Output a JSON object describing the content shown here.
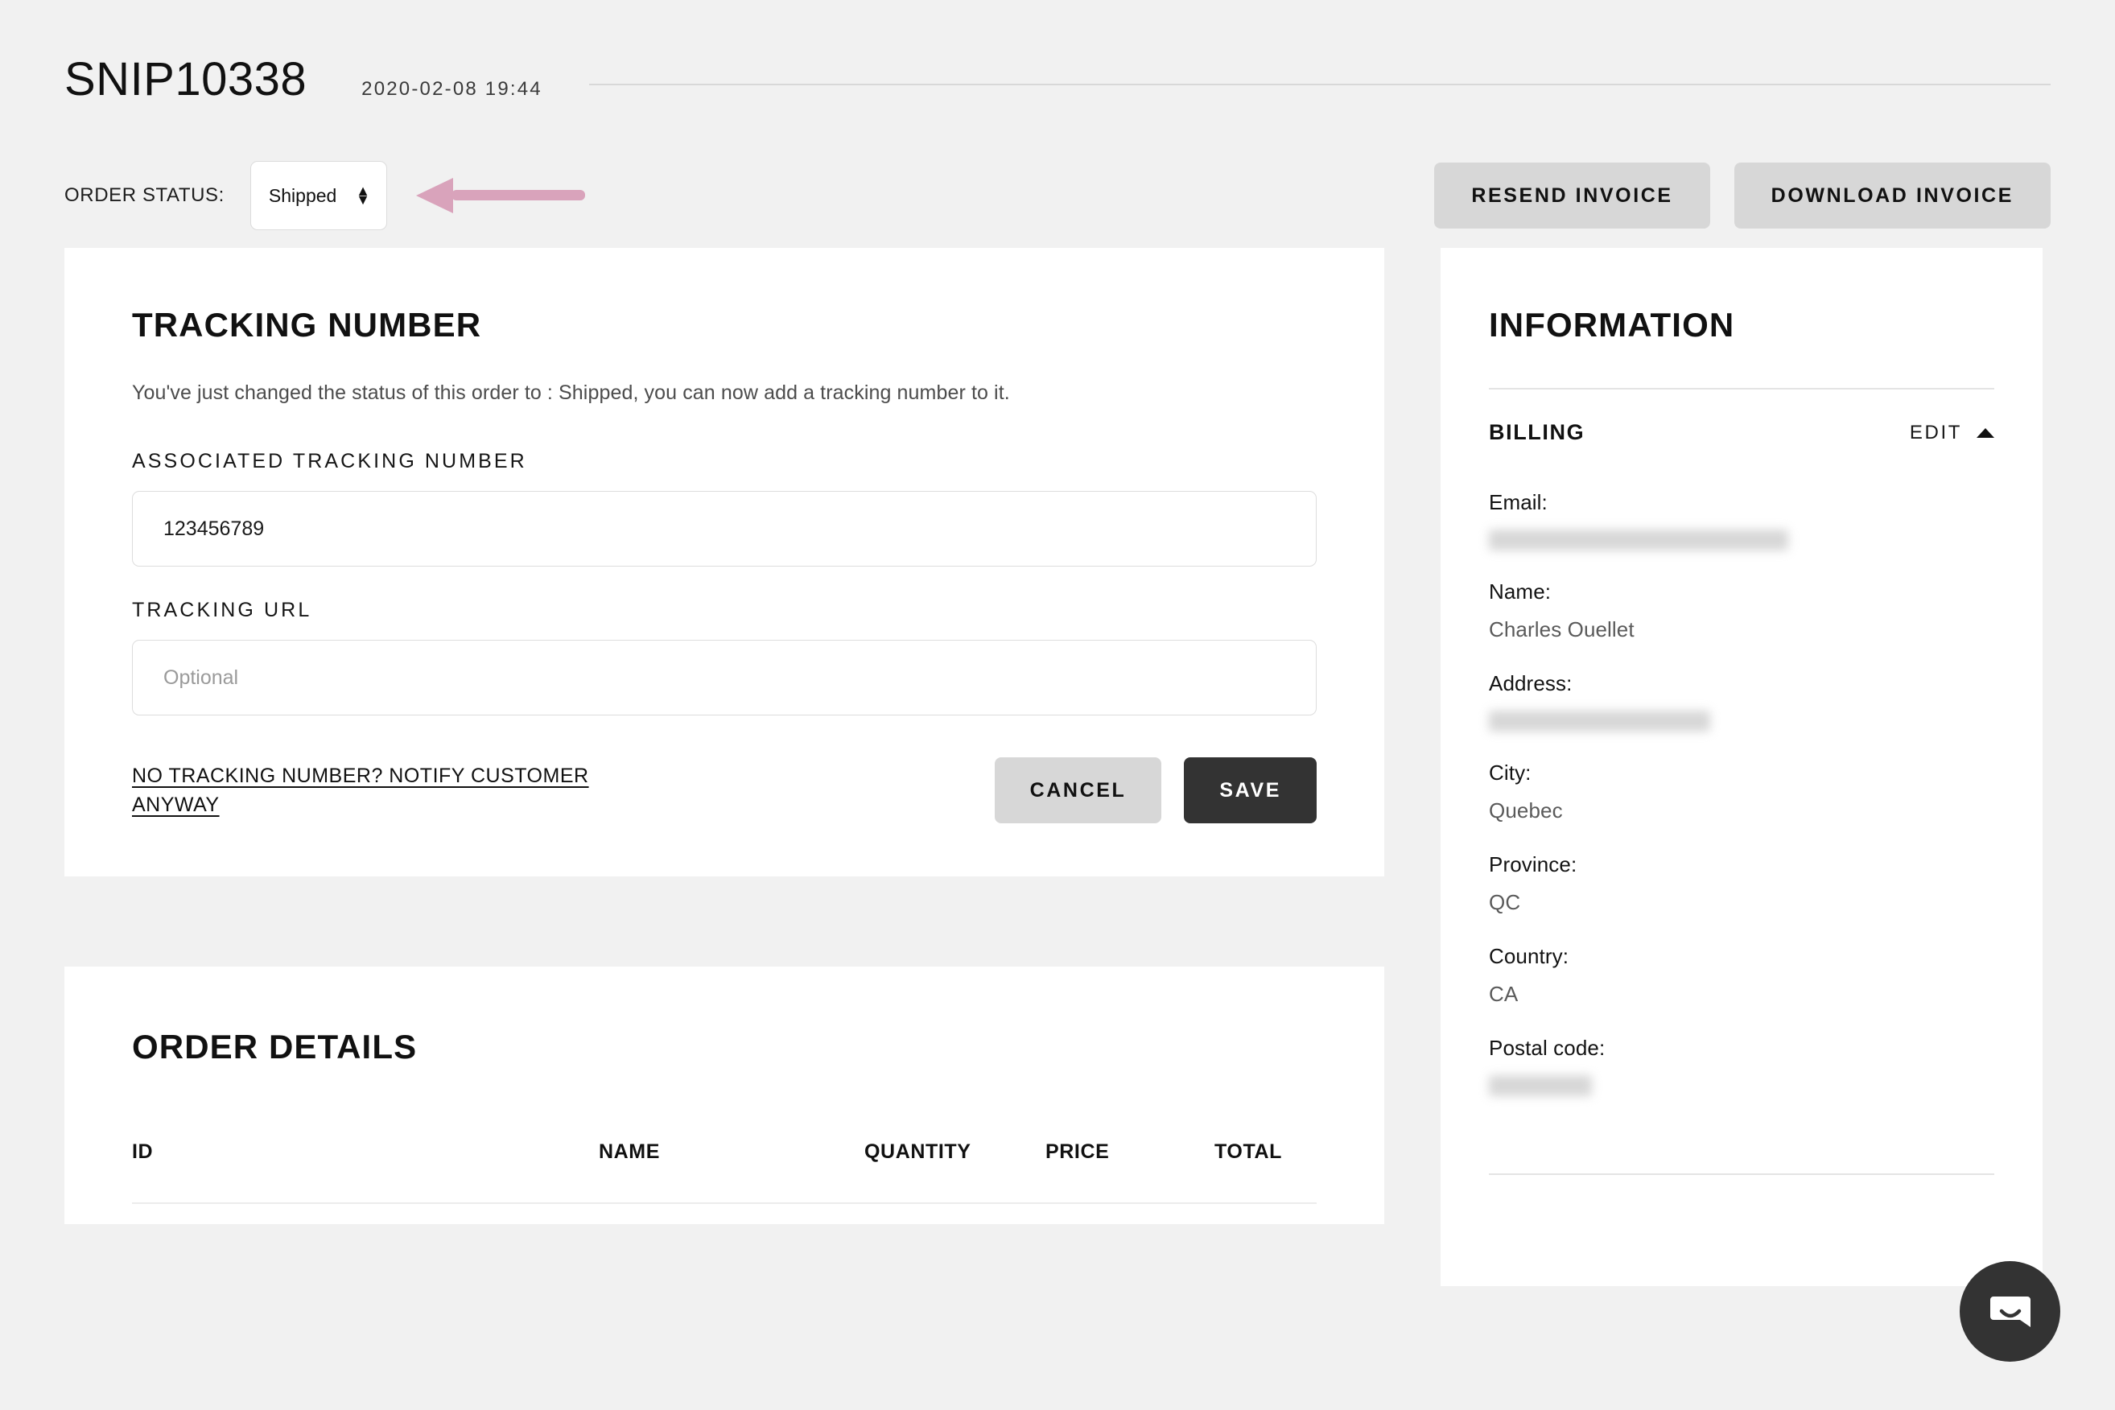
{
  "header": {
    "order_id": "SNIP10338",
    "order_date": "2020-02-08 19:44"
  },
  "status_bar": {
    "label": "ORDER STATUS:",
    "selected_status": "Shipped",
    "status_options": [
      "Shipped"
    ],
    "stepper_up": "▲",
    "stepper_down": "▼",
    "annotation_arrow_color": "#d9a3bb",
    "resend_invoice_label": "RESEND INVOICE",
    "download_invoice_label": "DOWNLOAD INVOICE"
  },
  "tracking": {
    "title": "TRACKING NUMBER",
    "description": "You've just changed the status of this order to : Shipped, you can now add a tracking number to it.",
    "tracking_number_label": "ASSOCIATED TRACKING NUMBER",
    "tracking_number_value": "123456789",
    "tracking_url_label": "TRACKING URL",
    "tracking_url_value": "",
    "tracking_url_placeholder": "Optional",
    "notify_link": "NO TRACKING NUMBER? NOTIFY CUSTOMER ANYWAY",
    "cancel_label": "CANCEL",
    "save_label": "SAVE"
  },
  "order_details": {
    "title": "ORDER DETAILS",
    "columns": [
      "ID",
      "NAME",
      "QUANTITY",
      "PRICE",
      "TOTAL"
    ],
    "rows": []
  },
  "information": {
    "title": "INFORMATION",
    "section_label": "BILLING",
    "edit_label": "EDIT",
    "fields": [
      {
        "key": "Email:",
        "value": "",
        "redacted": true
      },
      {
        "key": "Name:",
        "value": "Charles Ouellet",
        "redacted": false
      },
      {
        "key": "Address:",
        "value": "",
        "redacted": true
      },
      {
        "key": "City:",
        "value": "Quebec",
        "redacted": false
      },
      {
        "key": "Province:",
        "value": "QC",
        "redacted": false
      },
      {
        "key": "Country:",
        "value": "CA",
        "redacted": false
      },
      {
        "key": "Postal code:",
        "value": "",
        "redacted": true
      }
    ]
  },
  "chat": {
    "launcher_icon": "chat-bubble-smile-icon"
  }
}
